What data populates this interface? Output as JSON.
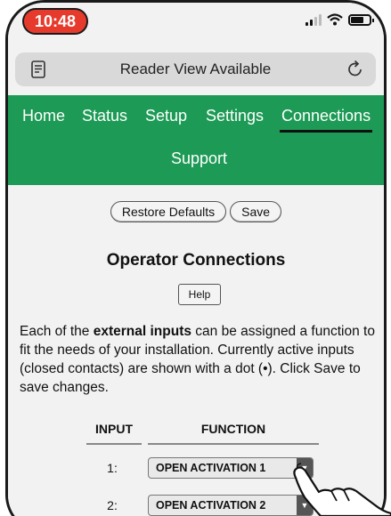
{
  "status_bar": {
    "time": "10:48"
  },
  "url_bar": {
    "text": "Reader View Available"
  },
  "nav": {
    "items": [
      {
        "label": "Home"
      },
      {
        "label": "Status"
      },
      {
        "label": "Setup"
      },
      {
        "label": "Settings"
      },
      {
        "label": "Connections",
        "active": true
      },
      {
        "label": "Support"
      }
    ]
  },
  "toolbar": {
    "restore_label": "Restore Defaults",
    "save_label": "Save"
  },
  "page": {
    "title": "Operator Connections",
    "help_label": "Help",
    "description_prefix": "Each of the ",
    "description_bold": "external inputs",
    "description_suffix": " can be assigned a function to fit the needs of your installation. Currently active inputs (closed contacts) are shown with a dot (•). Click Save to save changes."
  },
  "table": {
    "headers": {
      "input": "INPUT",
      "function": "FUNCTION"
    },
    "rows": [
      {
        "input": "1:",
        "function": "OPEN ACTIVATION 1"
      },
      {
        "input": "2:",
        "function": "OPEN ACTIVATION 2"
      }
    ]
  },
  "colors": {
    "nav_green": "#1d9a55",
    "time_pill": "#e63a2c"
  }
}
